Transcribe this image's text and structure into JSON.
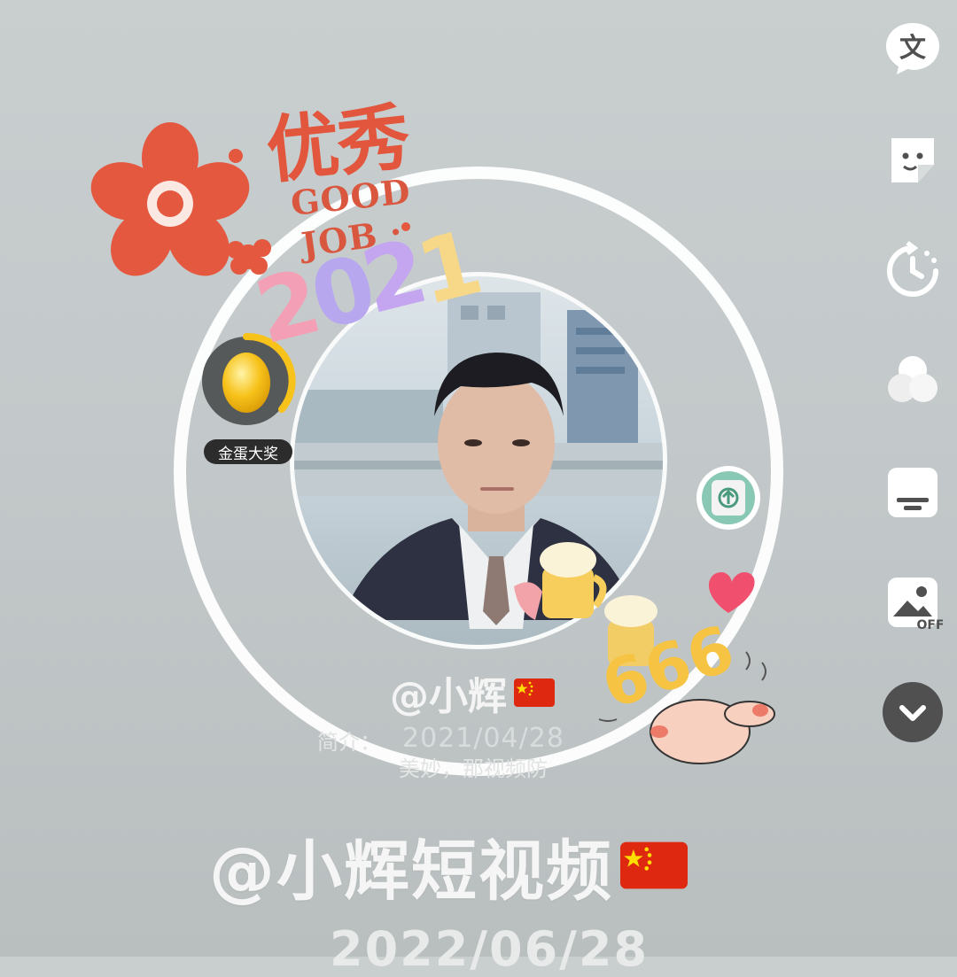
{
  "sticker": {
    "youxiu": "优秀",
    "good": "GOOD",
    "job": "JOB ·",
    "year": "2021",
    "num_666": "666"
  },
  "egg_widget": {
    "label": "金蛋大奖",
    "icon": "golden-egg-icon"
  },
  "inner_video": {
    "handle": "@小辉",
    "date": "2021/04/28",
    "bio_prefix": "简介：",
    "bio_text": "美妙，那视频防",
    "flag": "china-flag-icon"
  },
  "main": {
    "handle": "@小辉短视频",
    "date": "2022/06/28",
    "flag": "china-flag-icon"
  },
  "toolbar": {
    "tools": [
      {
        "name": "text-tool",
        "icon": "text-bubble-icon"
      },
      {
        "name": "sticker-tool",
        "icon": "sticker-icon"
      },
      {
        "name": "timer-tool",
        "icon": "timer-icon"
      },
      {
        "name": "filter-tool",
        "icon": "filter-circles-icon"
      },
      {
        "name": "caption-tool",
        "icon": "caption-icon"
      },
      {
        "name": "image-off-tool",
        "icon": "image-off-icon"
      },
      {
        "name": "collapse-tool",
        "icon": "chevron-down-icon"
      }
    ],
    "image_off_badge": "OFF",
    "text_tool_glyph": "文"
  },
  "colors": {
    "accent_red": "#e2563d",
    "heart": "#f0506e",
    "egg_gold": "#f7c21a",
    "toolbar_dark": "#505050"
  }
}
